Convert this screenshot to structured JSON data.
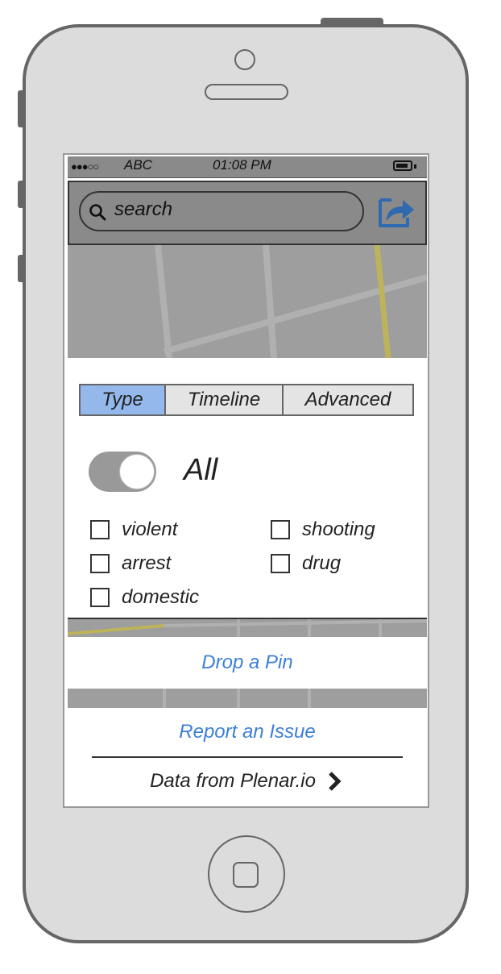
{
  "status_bar": {
    "signal": "●●●○○",
    "carrier": "ABC",
    "time": "01:08 PM"
  },
  "search": {
    "placeholder": "search"
  },
  "icons": {
    "search": "search-icon",
    "share": "share-icon",
    "chevron": "chevron-right-icon"
  },
  "filter": {
    "tabs": [
      {
        "label": "Type",
        "active": true
      },
      {
        "label": "Timeline",
        "active": false
      },
      {
        "label": "Advanced",
        "active": false
      }
    ],
    "all_label": "All",
    "all_toggle_on": true,
    "categories": [
      "violent",
      "shooting",
      "arrest",
      "drug",
      "domestic"
    ]
  },
  "actions": {
    "drop_pin": "Drop a Pin",
    "report_issue": "Report an Issue",
    "data_source": "Data from Plenar.io"
  },
  "colors": {
    "accent_link": "#3d7fd6",
    "active_tab": "#94b8ec",
    "share_icon": "#2f69b0"
  }
}
